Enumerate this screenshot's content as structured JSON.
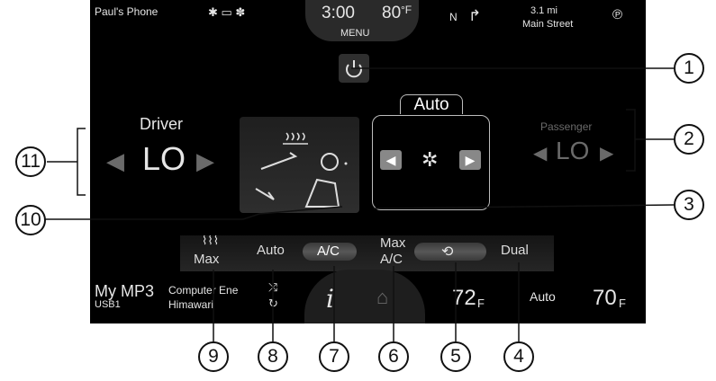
{
  "status_bar": {
    "phone_name": "Paul's Phone",
    "time": "3:00",
    "menu_label": "MENU",
    "temperature": "80",
    "temperature_unit": "°F",
    "compass": "N",
    "nav_distance": "3.1 mi",
    "nav_street": "Main Street"
  },
  "climate": {
    "driver_label": "Driver",
    "driver_temp": "LO",
    "passenger_label": "Passenger",
    "passenger_temp": "LO",
    "fan_mode": "Auto",
    "defrost_max_label": "Max",
    "auto_label": "Auto",
    "ac_label": "A/C",
    "max_ac_label_1": "Max",
    "max_ac_label_2": "A/C",
    "dual_label": "Dual"
  },
  "media_bar": {
    "source_title": "My MP3",
    "source_sub": "USB1",
    "track": "Computer Ene",
    "artist": "Himawari",
    "driver_temp": "72",
    "driver_unit": "F",
    "fan_status": "Auto",
    "passenger_temp": "70",
    "passenger_unit": "F"
  },
  "callouts": [
    "1",
    "2",
    "3",
    "4",
    "5",
    "6",
    "7",
    "8",
    "9",
    "10",
    "11"
  ],
  "colors": {
    "screen_bg": "#000000",
    "text": "#e6e6e6",
    "dim": "#6a6a6a",
    "callout_border": "#111111"
  }
}
